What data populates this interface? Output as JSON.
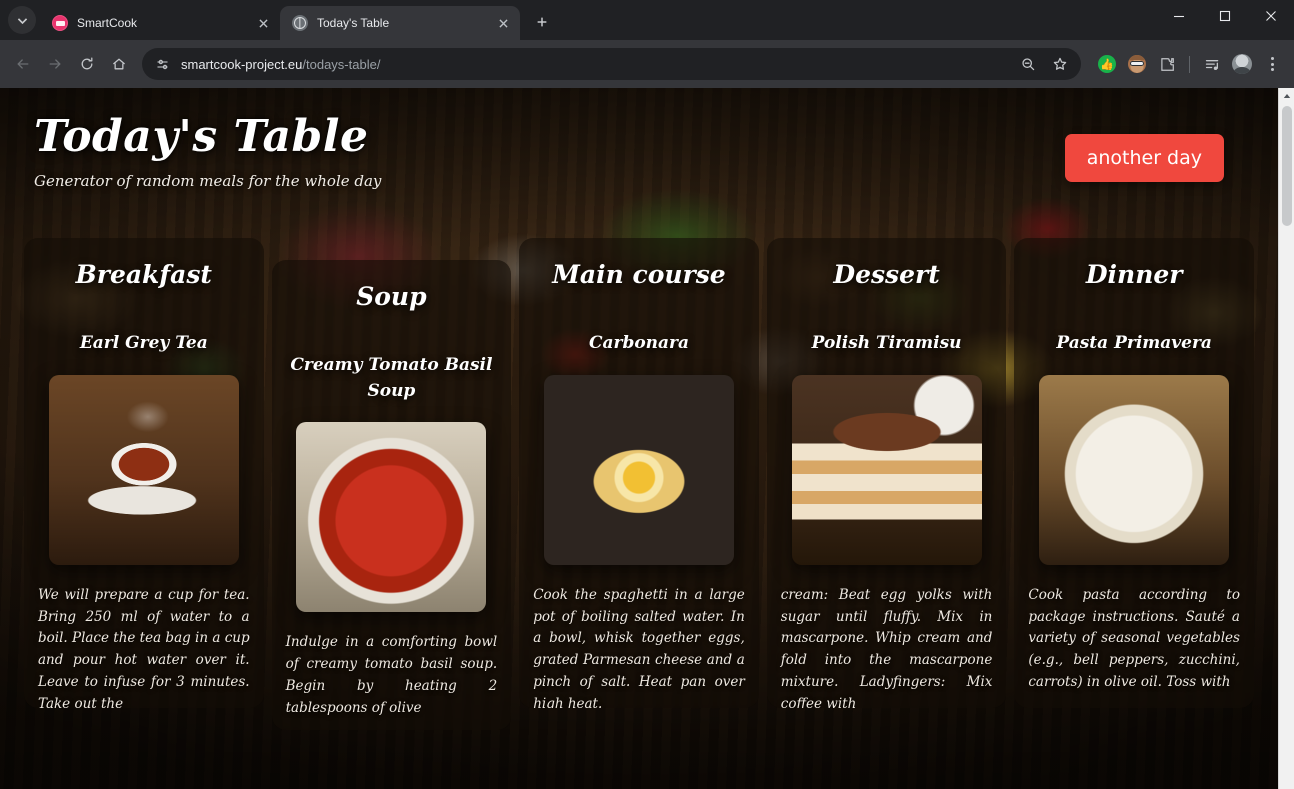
{
  "browser": {
    "tabs": [
      {
        "title": "SmartCook",
        "favicon": "smartcook-logo-icon",
        "active": false
      },
      {
        "title": "Today's Table",
        "favicon": "globe-icon",
        "active": true
      }
    ],
    "new_tab_label": "+",
    "nav": {
      "back": "back-arrow-icon",
      "forward": "forward-arrow-icon",
      "reload": "reload-icon",
      "home": "home-icon"
    },
    "omnibox": {
      "site_info_icon": "site-settings-icon",
      "url_domain": "smartcook-project.eu",
      "url_path": "/todays-table/",
      "zoom_out_icon": "zoom-out-icon",
      "bookmark_icon": "star-icon"
    },
    "extensions": [
      {
        "name": "thumbs-up-extension-icon",
        "glyph": "👍",
        "color": "#19b24a"
      },
      {
        "name": "face-avatar-extension-icon"
      },
      {
        "name": "puzzle-extensions-icon"
      }
    ],
    "reading_list_icon": "reading-list-icon",
    "profile_icon": "profile-avatar-icon",
    "menu_icon": "three-dot-menu-icon",
    "window_controls": {
      "minimize": "minimize-icon",
      "maximize": "maximize-icon",
      "close": "close-icon"
    }
  },
  "colors": {
    "accent_button": "#f0483e",
    "chrome_tabstrip": "#202124",
    "chrome_toolbar": "#35363a",
    "card_overlay": "rgba(20,13,7,0.62)"
  },
  "site": {
    "title": "Today's Table",
    "subtitle": "Generator of random meals for the whole day",
    "another_day_button": "another day",
    "cards": [
      {
        "heading": "Breakfast",
        "meal": "Earl Grey Tea",
        "photo": "tea-cup-photo",
        "description": "We will prepare a cup for tea. Bring 250 ml of water to a boil. Place the tea bag in a cup and pour hot water over it. Leave to infuse for 3 minutes. Take out the"
      },
      {
        "heading": "Soup",
        "meal": "Creamy Tomato Basil Soup",
        "photo": "tomato-soup-photo",
        "description": "Indulge in a comforting bowl of creamy tomato basil soup. Begin by heating 2 tablespoons of olive"
      },
      {
        "heading": "Main course",
        "meal": "Carbonara",
        "photo": "carbonara-photo",
        "description": "Cook the spaghetti in a large pot of boiling salted water. In a bowl, whisk together eggs, grated Parmesan cheese and a pinch of salt. Heat pan over high heat."
      },
      {
        "heading": "Dessert",
        "meal": "Polish Tiramisu",
        "photo": "tiramisu-photo",
        "description": "cream: Beat egg yolks with sugar until fluffy. Mix in mascarpone. Whip cream and fold into the mascarpone mixture. Ladyfingers: Mix coffee with"
      },
      {
        "heading": "Dinner",
        "meal": "Pasta Primavera",
        "photo": "pasta-primavera-photo",
        "description": "Cook pasta according to package instructions. Sauté a variety of seasonal vegetables (e.g., bell peppers, zucchini, carrots) in olive oil. Toss with"
      }
    ]
  }
}
